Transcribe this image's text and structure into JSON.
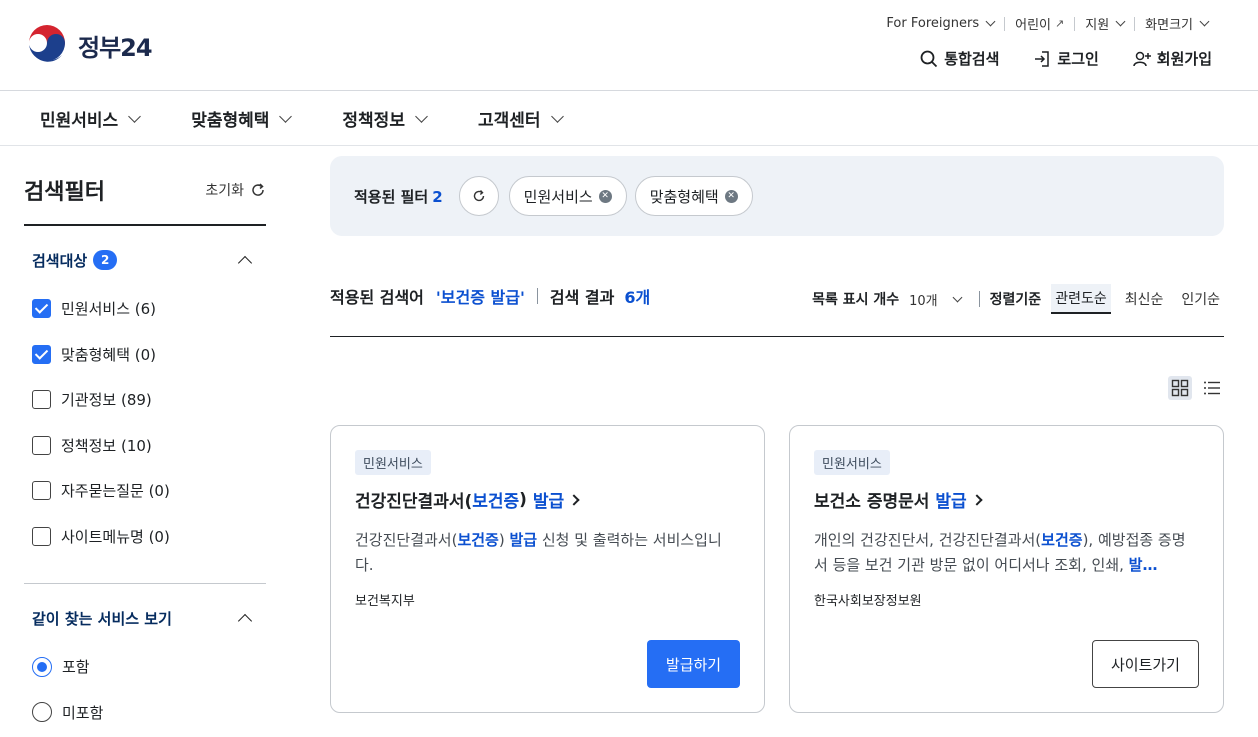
{
  "header": {
    "logo_text": "정부24",
    "util_links": [
      {
        "label": "For Foreigners"
      },
      {
        "label": "어린이"
      },
      {
        "label": "지원"
      },
      {
        "label": "화면크기"
      }
    ],
    "actions": {
      "search": "통합검색",
      "login": "로그인",
      "signup": "회원가입"
    }
  },
  "nav": {
    "items": [
      {
        "label": "민원서비스"
      },
      {
        "label": "맞춤형혜택"
      },
      {
        "label": "정책정보"
      },
      {
        "label": "고객센터"
      }
    ]
  },
  "sidebar": {
    "title": "검색필터",
    "reset_label": "초기화",
    "target_section": {
      "title": "검색대상",
      "badge": "2",
      "options": [
        {
          "label": "민원서비스 (6)",
          "checked": true
        },
        {
          "label": "맞춤형혜택 (0)",
          "checked": true
        },
        {
          "label": "기관정보 (89)",
          "checked": false
        },
        {
          "label": "정책정보 (10)",
          "checked": false
        },
        {
          "label": "자주묻는질문 (0)",
          "checked": false
        },
        {
          "label": "사이트메뉴명 (0)",
          "checked": false
        }
      ]
    },
    "related_section": {
      "title": "같이 찾는 서비스 보기",
      "options": [
        {
          "label": "포함",
          "selected": true
        },
        {
          "label": "미포함",
          "selected": false
        }
      ]
    }
  },
  "filters": {
    "label": "적용된 필터",
    "count": "2",
    "chips": [
      {
        "label": "민원서비스"
      },
      {
        "label": "맞춤형혜택"
      }
    ]
  },
  "results": {
    "keyword_label": "적용된 검색어",
    "keyword": "'보건증 발급'",
    "count_label": "검색 결과",
    "count": "6개",
    "page_size_label": "목록 표시 개수",
    "page_size": "10개",
    "sort_label": "정렬기준",
    "sort_options": [
      {
        "label": "관련도순",
        "active": true
      },
      {
        "label": "최신순",
        "active": false
      },
      {
        "label": "인기순",
        "active": false
      }
    ]
  },
  "cards": [
    {
      "tag": "민원서비스",
      "title_pre": "건강진단결과서(",
      "title_hl1": "보건증",
      "title_mid": ") ",
      "title_hl2": "발급",
      "desc_pre": "건강진단결과서(",
      "desc_hl1": "보건증",
      "desc_mid": ") ",
      "desc_hl2": "발급",
      "desc_post": " 신청 및 출력하는 서비스입니다.",
      "org": "보건복지부",
      "button": "발급하기"
    },
    {
      "tag": "민원서비스",
      "title_pre": "보건소 증명문서 ",
      "title_hl": "발급",
      "desc_pre": "개인의 건강진단서, 건강진단결과서(",
      "desc_hl1": "보건증",
      "desc_mid": "), 예방접종 증명서 등을 보건 기관 방문 없이 어디서나 조회, 인쇄, ",
      "desc_hl2": "발…",
      "org": "한국사회보장정보원",
      "button": "사이트가기"
    }
  ],
  "colors": {
    "accent": "#256ef4",
    "highlight": "#0b50d0",
    "navy": "#052b5e",
    "filter_bg": "#eef2f7"
  }
}
